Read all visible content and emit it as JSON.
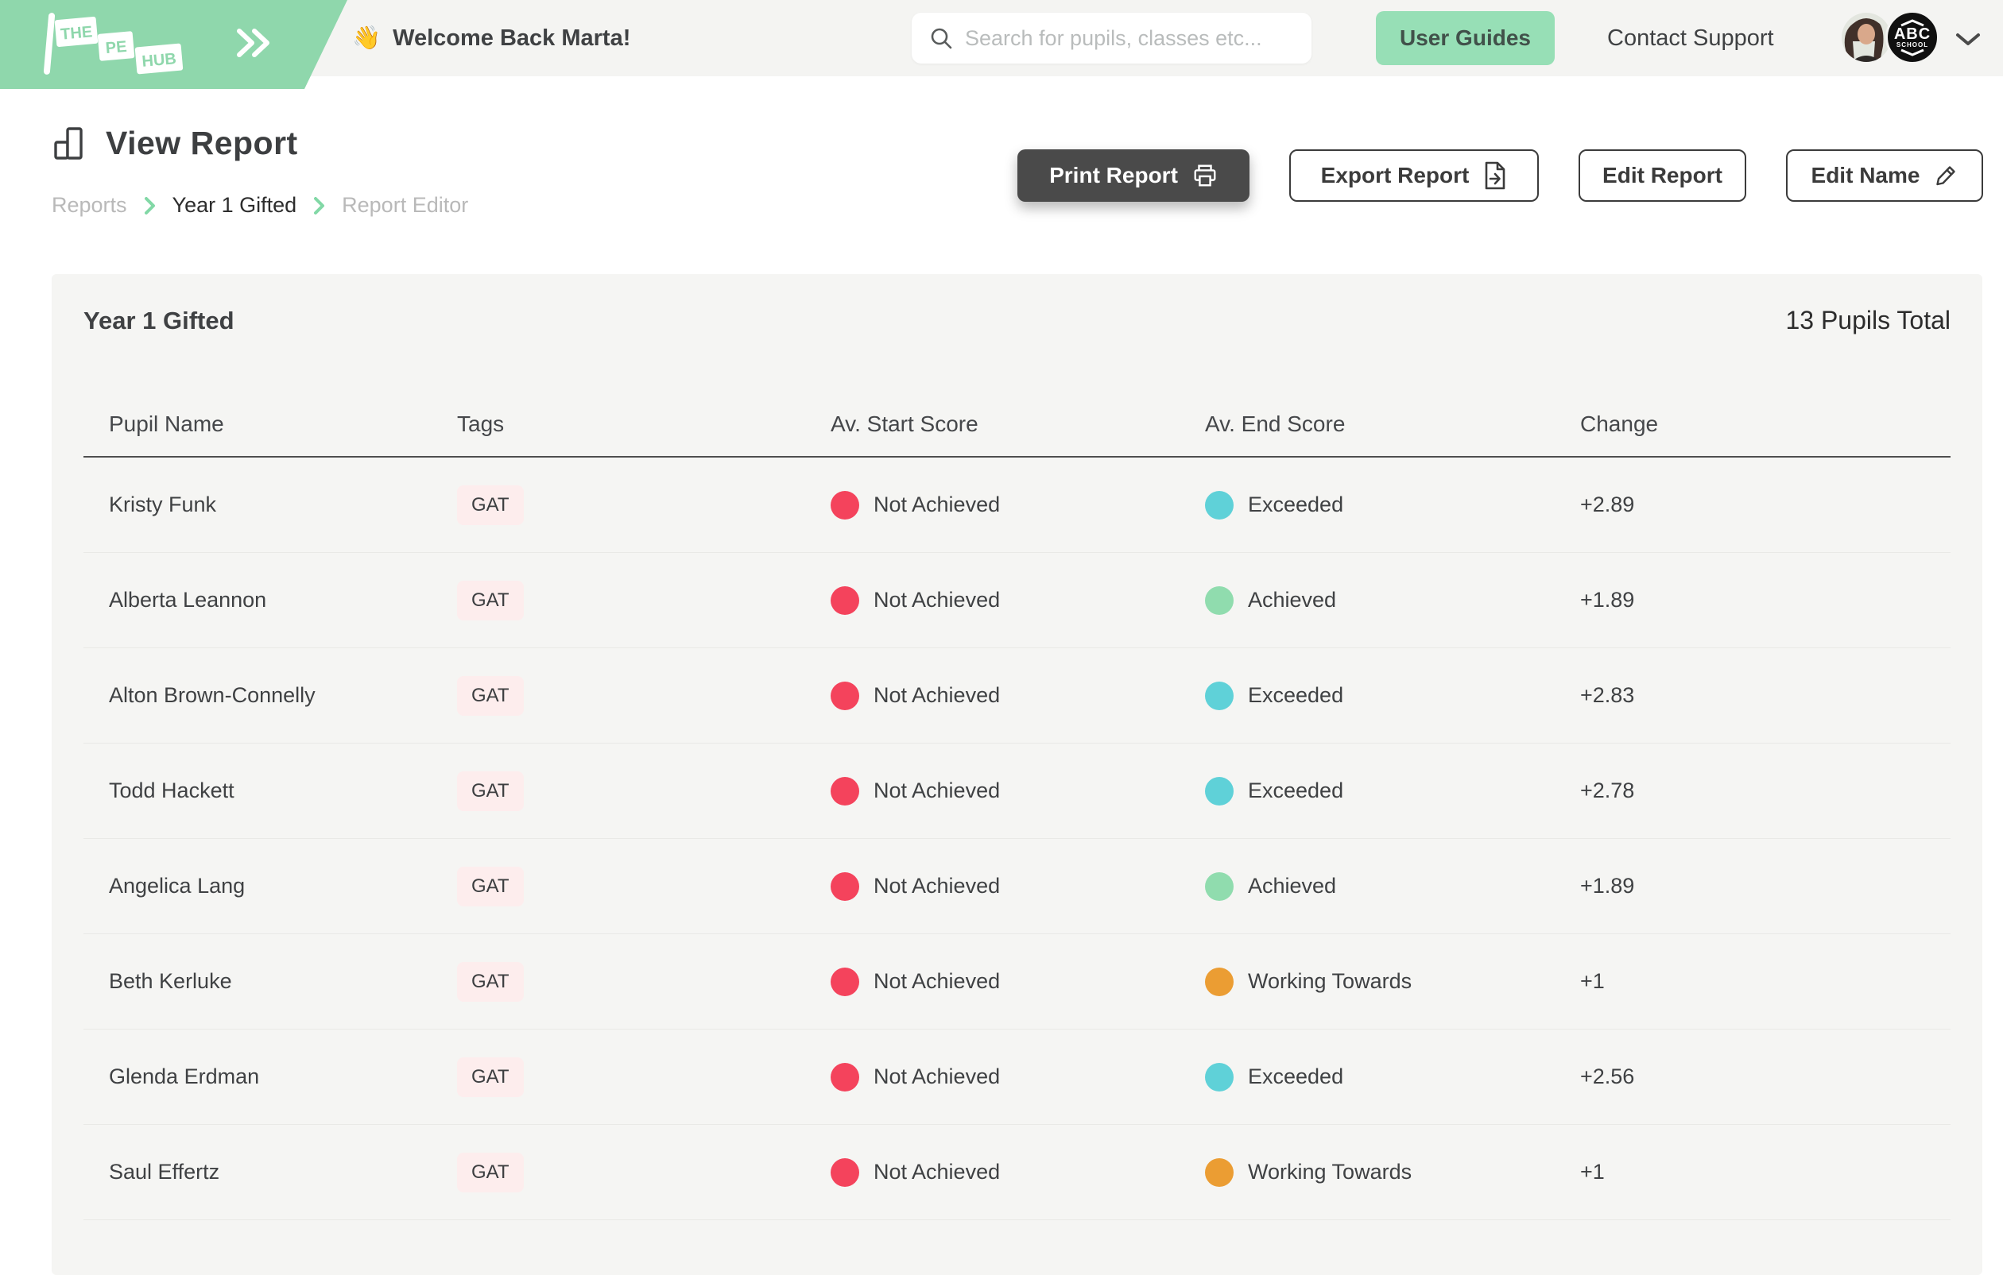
{
  "header": {
    "logo": {
      "the": "THE",
      "pe": "PE",
      "hub": "HUB"
    },
    "wave_emoji": "👋",
    "welcome_text": "Welcome Back Marta!",
    "search": {
      "placeholder": "Search for pupils, classes etc..."
    },
    "user_guides_label": "User Guides",
    "contact_support_label": "Contact Support",
    "school_badge": {
      "name": "ABC",
      "sub": "SCHOOL"
    }
  },
  "page": {
    "title": "View Report",
    "breadcrumb": [
      {
        "label": "Reports"
      },
      {
        "label": "Year 1 Gifted"
      },
      {
        "label": "Report Editor"
      }
    ],
    "actions": {
      "print_label": "Print Report",
      "export_label": "Export Report",
      "edit_report_label": "Edit Report",
      "edit_name_label": "Edit Name"
    }
  },
  "report": {
    "title": "Year 1 Gifted",
    "pupils_total": "13 Pupils Total",
    "columns": [
      "Pupil Name",
      "Tags",
      "Av. Start Score",
      "Av. End Score",
      "Change"
    ],
    "status_colors": {
      "Not Achieved": "#f4435c",
      "Working Towards": "#eb9d33",
      "Achieved": "#90dcae",
      "Exceeded": "#5fd1d8"
    },
    "rows": [
      {
        "name": "Kristy Funk",
        "tags": [
          "GAT"
        ],
        "start": "Not Achieved",
        "end": "Exceeded",
        "change": "+2.89"
      },
      {
        "name": "Alberta Leannon",
        "tags": [
          "GAT"
        ],
        "start": "Not Achieved",
        "end": "Achieved",
        "change": "+1.89"
      },
      {
        "name": "Alton Brown-Connelly",
        "tags": [
          "GAT"
        ],
        "start": "Not Achieved",
        "end": "Exceeded",
        "change": "+2.83"
      },
      {
        "name": "Todd Hackett",
        "tags": [
          "GAT"
        ],
        "start": "Not Achieved",
        "end": "Exceeded",
        "change": "+2.78"
      },
      {
        "name": "Angelica Lang",
        "tags": [
          "GAT"
        ],
        "start": "Not Achieved",
        "end": "Achieved",
        "change": "+1.89"
      },
      {
        "name": "Beth Kerluke",
        "tags": [
          "GAT"
        ],
        "start": "Not Achieved",
        "end": "Working Towards",
        "change": "+1"
      },
      {
        "name": "Glenda Erdman",
        "tags": [
          "GAT"
        ],
        "start": "Not Achieved",
        "end": "Exceeded",
        "change": "+2.56"
      },
      {
        "name": "Saul Effertz",
        "tags": [
          "GAT"
        ],
        "start": "Not Achieved",
        "end": "Working Towards",
        "change": "+1"
      }
    ]
  },
  "colors": {
    "brand_green": "#8fd7ac",
    "button_green": "#97dfb6",
    "dark_button_gray": "#4a4a4a"
  }
}
